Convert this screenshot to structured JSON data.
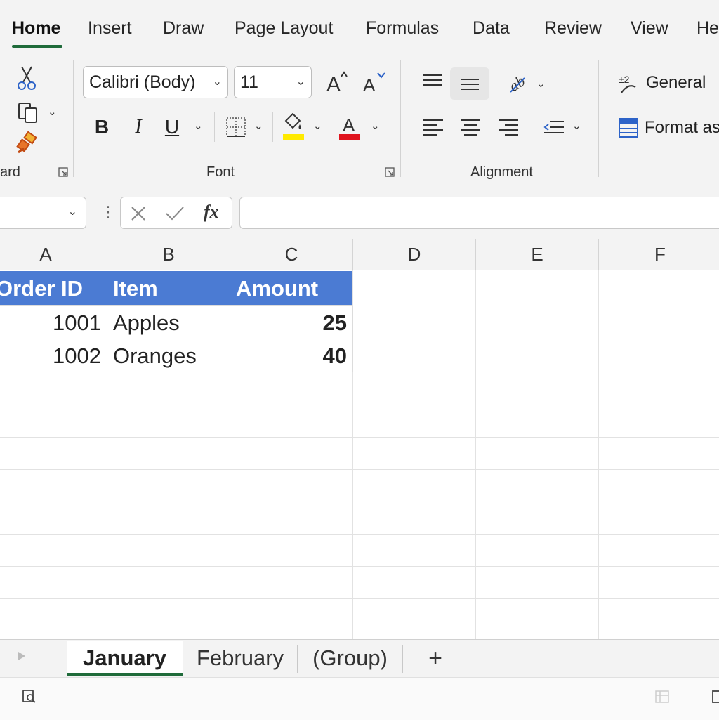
{
  "ribbon_tabs": {
    "home": "Home",
    "insert": "Insert",
    "draw": "Draw",
    "page_layout": "Page Layout",
    "formulas": "Formulas",
    "data": "Data",
    "review": "Review",
    "view": "View",
    "help_partial": "He"
  },
  "ribbon": {
    "clipboard_label": "ard",
    "font_label": "Font",
    "alignment_label": "Alignment",
    "font_name": "Calibri (Body)",
    "font_size": "11",
    "number_format": "General",
    "format_as_table": "Format as",
    "bold_glyph": "B",
    "italic_glyph": "I",
    "underline_glyph": "U",
    "font_color_glyph": "A",
    "highlight_color": "#ffea00",
    "font_color": "#e0141e"
  },
  "formula_bar": {
    "fx": "fx",
    "formula_value": ""
  },
  "columns": [
    "A",
    "B",
    "C",
    "D",
    "E",
    "F"
  ],
  "table": {
    "headers": [
      "Order ID",
      "Item",
      "Amount"
    ],
    "rows": [
      [
        "1001",
        "Apples",
        "25"
      ],
      [
        "1002",
        "Oranges",
        "40"
      ]
    ],
    "header_color": "#4b7bd3"
  },
  "sheets": {
    "tabs": [
      "January",
      "February",
      "(Group)"
    ],
    "active": "January",
    "add": "+"
  },
  "colors": {
    "accent": "#1f6b3a"
  }
}
